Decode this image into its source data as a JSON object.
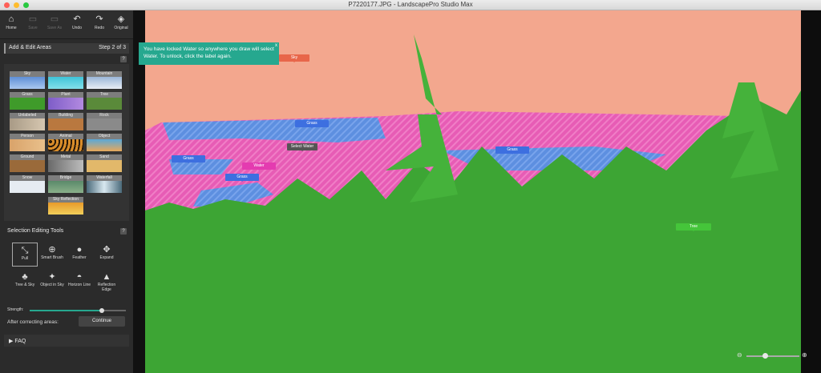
{
  "window": {
    "title": "P7220177.JPG - LandscapePro Studio Max"
  },
  "toolbar": {
    "items": [
      {
        "label": "Home",
        "icon": "home-icon"
      },
      {
        "label": "Save",
        "icon": "save-icon"
      },
      {
        "label": "Save As",
        "icon": "save-as-icon"
      },
      {
        "label": "Undo",
        "icon": "undo-icon"
      },
      {
        "label": "Redo",
        "icon": "redo-icon"
      },
      {
        "label": "Original",
        "icon": "original-icon"
      }
    ]
  },
  "areas": {
    "title": "Add & Edit Areas",
    "step": "Step 2 of 3",
    "help": "?",
    "tiles": [
      "Sky",
      "Water",
      "Mountain",
      "Grass",
      "Plant",
      "Tree",
      "Unlabeled",
      "Building",
      "Rock",
      "Person",
      "Animal",
      "Object",
      "Ground",
      "Metal",
      "Sand",
      "Snow",
      "Bridge",
      "Waterfall",
      "Sky Reflection"
    ]
  },
  "tools": {
    "title": "Selection Editing Tools",
    "help": "?",
    "items": [
      "Pull",
      "Smart Brush",
      "Feather",
      "Expand",
      "Tree & Sky",
      "Object in Sky",
      "Horizon Line",
      "Reflection Edge"
    ],
    "strength_label": "Strength:",
    "strength_value": 0.75
  },
  "correct": {
    "label": "After correcting areas:",
    "button": "Continue"
  },
  "faq": {
    "label": "▶ FAQ"
  },
  "tooltip": {
    "text": "You have locked Water so anywhere you draw will select Water.  To unlock, click the label again.",
    "close": "x"
  },
  "labels": {
    "sky": "Sky",
    "grass1": "Grass",
    "grass2": "Grass",
    "grass3": "Grass",
    "grass4": "Grass",
    "water": "Water",
    "select_water": "Select Water",
    "tree": "Tree"
  },
  "zoom": {
    "minus": "⊖",
    "plus": "⊕",
    "value": 0.35
  },
  "colors": {
    "sky": "#f2a58c",
    "water": "#5b8ff0",
    "grass_tag": "#3d6fe0",
    "water_tag": "#e43bb0",
    "sky_tag": "#e8664a",
    "tree_tag": "#45c53a",
    "accent": "#26a88f"
  }
}
